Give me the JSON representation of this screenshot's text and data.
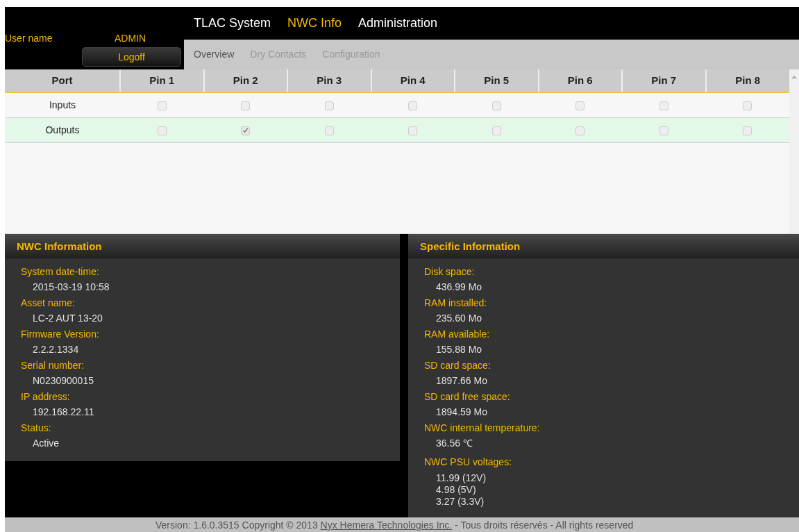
{
  "user": {
    "label": "User name",
    "name": "ADMIN",
    "logoff": "Logoff"
  },
  "nav": [
    {
      "label": "TLAC System",
      "selected": false
    },
    {
      "label": "NWC Info",
      "selected": true
    },
    {
      "label": "Administration",
      "selected": false
    }
  ],
  "subnav": [
    {
      "label": "Overview",
      "selected": true
    },
    {
      "label": "Dry Contacts",
      "selected": false
    },
    {
      "label": "Configuration",
      "selected": false
    }
  ],
  "table": {
    "columns": [
      "Port",
      "Pin 1",
      "Pin 2",
      "Pin 3",
      "Pin 4",
      "Pin 5",
      "Pin 6",
      "Pin 7",
      "Pin 8"
    ],
    "rows": [
      {
        "port": "Inputs",
        "selected": false,
        "pins": [
          false,
          false,
          false,
          false,
          false,
          false,
          false,
          false
        ]
      },
      {
        "port": "Outputs",
        "selected": true,
        "pins": [
          false,
          true,
          false,
          false,
          false,
          false,
          false,
          false
        ]
      }
    ]
  },
  "panels": [
    {
      "title": "NWC Information",
      "items": [
        {
          "label": "System date-time:",
          "values": [
            "2015-03-19 10:58"
          ]
        },
        {
          "label": "Asset name:",
          "values": [
            "LC-2 AUT 13-20"
          ]
        },
        {
          "label": "Firmware Version:",
          "values": [
            "2.2.2.1334"
          ]
        },
        {
          "label": "Serial number:",
          "values": [
            "N0230900015"
          ]
        },
        {
          "label": "IP address:",
          "values": [
            "192.168.22.11"
          ]
        },
        {
          "label": "Status:",
          "values": [
            "Active"
          ]
        }
      ]
    },
    {
      "title": "Specific Information",
      "items": [
        {
          "label": "Disk space:",
          "values": [
            "436.99 Mo"
          ]
        },
        {
          "label": "RAM installed:",
          "values": [
            "235.60 Mo"
          ]
        },
        {
          "label": "RAM available:",
          "values": [
            "155.88 Mo"
          ]
        },
        {
          "label": "SD card space:",
          "values": [
            "1897.66 Mo"
          ]
        },
        {
          "label": "SD card free space:",
          "values": [
            "1894.59 Mo"
          ]
        },
        {
          "label": "NWC internal temperature:",
          "values": [
            "36.56 ℃"
          ]
        },
        {
          "label": "NWC PSU voltages:",
          "values": [
            "11.99 (12V)",
            "4.98 (5V)",
            "3.27 (3.3V)"
          ]
        }
      ]
    }
  ],
  "footer": {
    "before": "Version: 1.6.0.3515 Copyright © 2013",
    "link": "Nyx Hemera Technologies Inc.",
    "after": "- Tous droits réservés - All rights reserved"
  }
}
